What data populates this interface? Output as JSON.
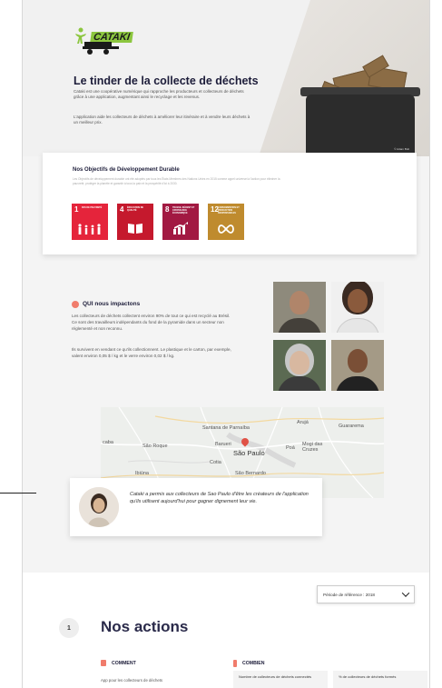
{
  "hero": {
    "logo_text": "CATAKI",
    "title": "Le tinder de la collecte de déchets",
    "paragraph1": "Cataki est une coopérative numérique qui rapproche les producteurs et collecteurs de déchets grâce à une application, augmentant ainsi le recyclage et les revenus.",
    "paragraph2": "L'application aide les collecteurs de déchets à améliorer leur itinéraire et à vendre leurs déchets à un meilleur prix.",
    "photo_credit": "© Adam Bolt"
  },
  "sdg": {
    "title": "Nos Objectifs de Développement Durable",
    "description": "Les Objectifs de développement durable ont été adoptés par tous les États Membres des Nations Unies en 2015 comme appel universel à l'action pour éliminer la pauvreté, protéger la planète et garantir à tous la paix et la prospérité d'ici à 2030.",
    "tiles": [
      {
        "number": "1",
        "name": "PAS DE PAUVRETÉ",
        "color": "#e5243b",
        "glyph": "👨‍👩‍👧‍👦"
      },
      {
        "number": "4",
        "name": "ÉDUCATION DE QUALITÉ",
        "color": "#c5192d",
        "glyph": "📖"
      },
      {
        "number": "8",
        "name": "TRAVAIL DÉCENT ET CROISSANCE ÉCONOMIQUE",
        "color": "#a21942",
        "glyph": "📈"
      },
      {
        "number": "12",
        "name": "CONSOMMATION ET PRODUCTION RESPONSABLES",
        "color": "#bf8b2e",
        "glyph": "∞"
      }
    ]
  },
  "qui": {
    "title": "QUI nous impactons",
    "paragraph1": "Les collecteurs de déchets collectent environ 90% de tout ce qui est recyclé au Brésil. Ce sont des travailleurs indépendants du fond de la pyramide dans un secteur non réglementé et non reconnu.",
    "paragraph2": "Ils survivent en vendant ce qu'ils collectionnent. Le plastique et le carton, par exemple, valent environ 0,05 $ / kg et le verre environ 0,02 $ / kg."
  },
  "map": {
    "labels": {
      "santana": "Santana de Parnaíba",
      "caba": "caba",
      "saoroque": "São Roque",
      "barueri": "Barueri",
      "saopaulo": "São Paulo",
      "cotia": "Cotia",
      "ibiuna": "Ibiúna",
      "saobernardo": "São Bernardo",
      "aruja": "Arujá",
      "guararema": "Guararema",
      "poa": "Poá",
      "mogi": "Mogi das Cruzes"
    }
  },
  "quote": {
    "text": "Cataki a permis aux collecteurs de Sao Paulo d'être les créateurs de l'application qu'ils utilisent aujourd'hui pour gagner dignement leur vie."
  },
  "lower": {
    "period_label": "Période de référence : 2018",
    "step_number": "1",
    "actions_title": "Nos actions",
    "col1_title": "COMMENT",
    "col1_text": "App pour les collecteurs de déchets",
    "col2_title": "COMBIEN",
    "stat1": "Nombre de collecteurs de déchets connectés",
    "stat2": "% de collecteurs de déchets formés"
  },
  "colors": {
    "accent_coral": "#f07c6c",
    "logo_green": "#8cc63f",
    "title_navy": "#1d1d3a"
  }
}
